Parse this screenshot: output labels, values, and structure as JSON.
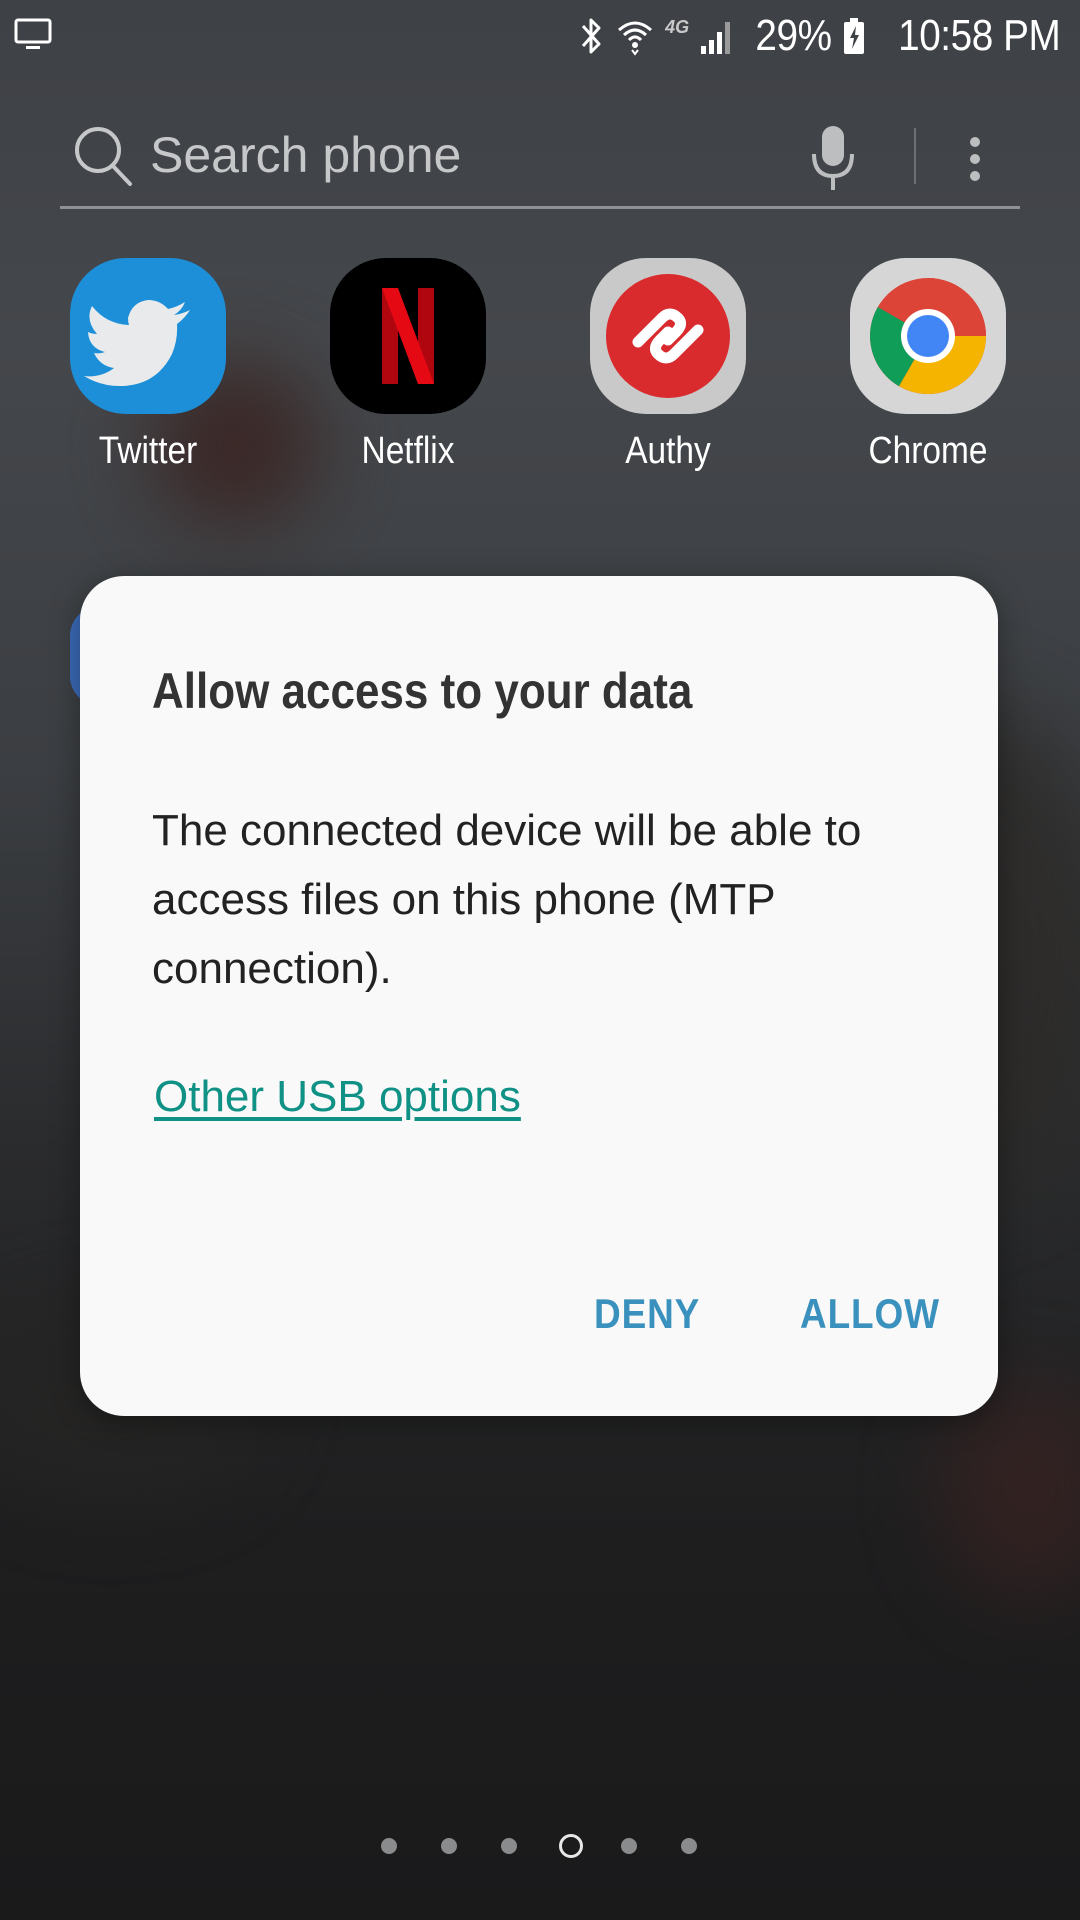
{
  "status_bar": {
    "battery": "29%",
    "time": "10:58 PM",
    "network_badge": "4G",
    "icons": [
      "cast-screen-icon",
      "bluetooth-icon",
      "wifi-icon",
      "signal-icon",
      "battery-charging-icon"
    ]
  },
  "search": {
    "placeholder": "Search phone",
    "icons": [
      "search-icon",
      "mic-icon",
      "more-vertical-icon"
    ]
  },
  "apps": [
    {
      "label": "Twitter",
      "color": "#1d8fd8"
    },
    {
      "label": "Netflix",
      "color": "#000000"
    },
    {
      "label": "Authy",
      "color": "#d92b2e"
    },
    {
      "label": "Chrome",
      "color": "#ffffff"
    }
  ],
  "dialog": {
    "title": "Allow access to your data",
    "message": "The connected device will be able to access files on this phone (MTP connection).",
    "link": "Other USB options",
    "deny_label": "DENY",
    "allow_label": "ALLOW",
    "link_color": "#0f9185",
    "button_color": "#3a91bd"
  },
  "page_indicator": {
    "pages": 6,
    "current": 4
  }
}
